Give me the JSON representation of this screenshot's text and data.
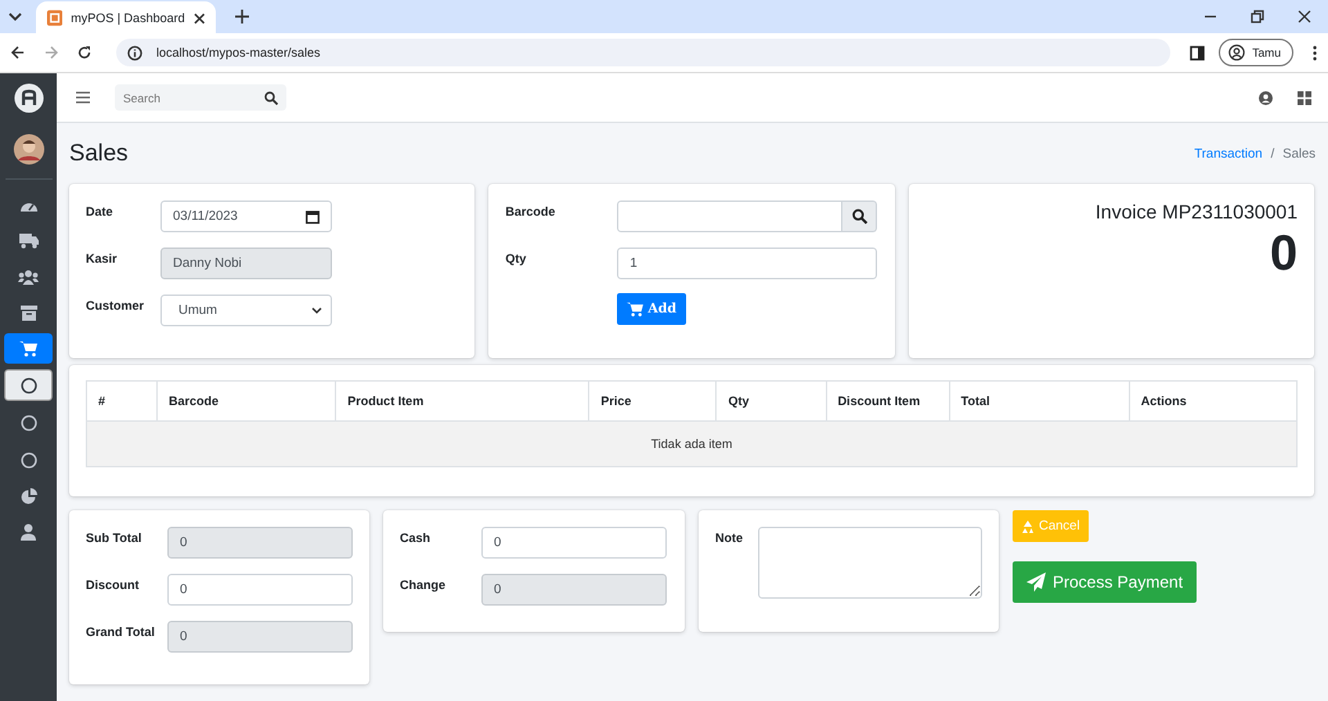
{
  "browser": {
    "tab_title": "myPOS | Dashboard",
    "url": "localhost/mypos-master/sales",
    "profile": "Tamu"
  },
  "topbar": {
    "search": {
      "placeholder": "Search"
    }
  },
  "sidebar": {
    "items": [
      {
        "selected": false
      },
      {
        "selected": false
      },
      {
        "selected": false
      },
      {
        "selected": false
      },
      {
        "selected": true,
        "children": [
          {
            "selected": true
          },
          {
            "selected": false
          },
          {
            "selected": false
          }
        ]
      },
      {
        "selected": false
      },
      {
        "selected": false
      }
    ]
  },
  "page": {
    "title": "Sales",
    "breadcrumb_separator": "/",
    "breadcrumb": [
      {
        "label": "Transaction",
        "link": true
      },
      {
        "label": "Sales",
        "link": false
      }
    ]
  },
  "sale_info": [
    {
      "label": "Date",
      "kind": "date",
      "value": "03/11/2023",
      "disabled": false
    },
    {
      "label": "Kasir",
      "kind": "text",
      "value": "Danny Nobi",
      "disabled": true
    },
    {
      "label": "Customer",
      "kind": "select",
      "value": "Umum",
      "disabled": false
    }
  ],
  "item_entry": {
    "fields": [
      {
        "label": "Barcode",
        "kind": "search",
        "disabled": false
      },
      {
        "label": "Qty",
        "kind": "text",
        "value": "1",
        "disabled": false
      }
    ],
    "add_button": "Add"
  },
  "invoice": {
    "label": "Invoice",
    "number": "MP2311030001",
    "total": "0"
  },
  "table": {
    "columns": [
      "#",
      "Barcode",
      "Product Item",
      "Price",
      "Qty",
      "Discount Item",
      "Total",
      "Actions"
    ],
    "empty_text": "Tidak ada item"
  },
  "totals": [
    {
      "label": "Sub Total",
      "value": "0",
      "disabled": true
    },
    {
      "label": "Discount",
      "value": "0",
      "disabled": false
    },
    {
      "label": "Grand Total",
      "value": "0",
      "disabled": true
    }
  ],
  "payment": [
    {
      "label": "Cash",
      "value": "0",
      "disabled": false
    },
    {
      "label": "Change",
      "value": "0",
      "disabled": true
    }
  ],
  "note": {
    "label": "Note"
  },
  "buttons": {
    "cancel": "Cancel",
    "process": "Process Payment"
  }
}
